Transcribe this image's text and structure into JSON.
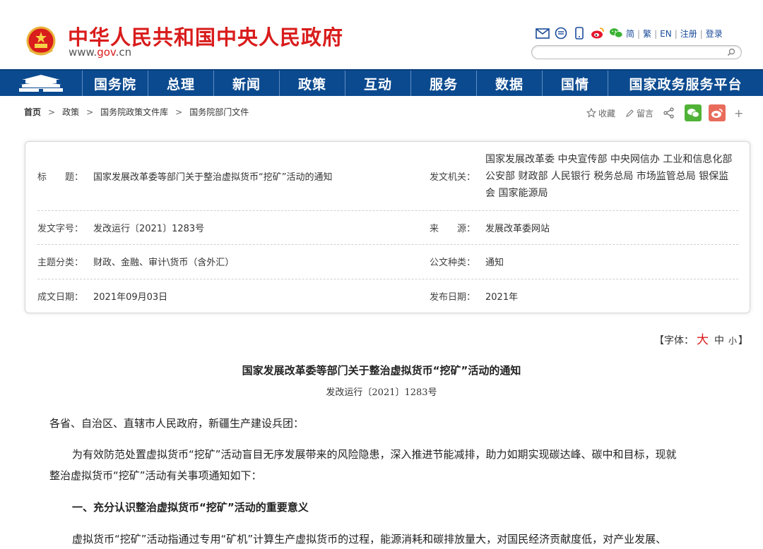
{
  "header": {
    "site_title": "中华人民共和国中央人民政府",
    "url_prefix": "www.",
    "url_domain": "gov",
    "url_suffix": ".cn",
    "links": [
      "简",
      "繁",
      "EN",
      "注册",
      "登录"
    ],
    "accent_red": "#d91c1c",
    "nav_blue": "#0b4a8f"
  },
  "nav": {
    "items": [
      "国务院",
      "总理",
      "新闻",
      "政策",
      "互动",
      "服务",
      "数据",
      "国情",
      "国家政务服务平台"
    ]
  },
  "breadcrumb": [
    "首页",
    "政策",
    "国务院政策文件库",
    "国务院部门文件"
  ],
  "tools": {
    "favorite": "收藏",
    "comment": "留言"
  },
  "info": {
    "title_label": "标　　题：",
    "title_value": "国家发展改革委等部门关于整治虚拟货币“挖矿”活动的通知",
    "issuer_label": "发文机关：",
    "issuer_value": "国家发展改革委  中央宣传部  中央网信办  工业和信息化部  公安部  财政部  人民银行  税务总局  市场监管总局  银保监会  国家能源局",
    "docno_label": "发文字号：",
    "docno_value": "发改运行〔2021〕1283号",
    "source_label": "来　　源：",
    "source_value": "发展改革委网站",
    "topic_label": "主题分类：",
    "topic_value": "财政、金融、审计\\货币（含外汇）",
    "type_label": "公文种类：",
    "type_value": "通知",
    "written_label": "成文日期：",
    "written_value": "2021年09月03日",
    "published_label": "发布日期：",
    "published_value": "2021年"
  },
  "font_control": {
    "prefix": "【字体：",
    "large": "大",
    "medium": "中",
    "small": "小",
    "suffix": "】"
  },
  "article": {
    "title": "国家发展改革委等部门关于整治虚拟货币“挖矿”活动的通知",
    "number": "发改运行〔2021〕1283号",
    "salutation": "各省、自治区、直辖市人民政府，新疆生产建设兵团：",
    "para1_line1": "为有效防范处置虚拟货币“挖矿”活动盲目无序发展带来的风险隐患，深入推进节能减排，助力如期实现碳达峰、碳中和目标，现就",
    "para1_line2": "整治虚拟货币“挖矿”活动有关事项通知如下：",
    "section1": "一、充分认识整治虚拟货币“挖矿”活动的重要意义",
    "para2_line1": "虚拟货币“挖矿”活动指通过专用“矿机”计算生产虚拟货币的过程，能源消耗和碳排放量大，对国民经济贡献度低，对产业发展、"
  }
}
